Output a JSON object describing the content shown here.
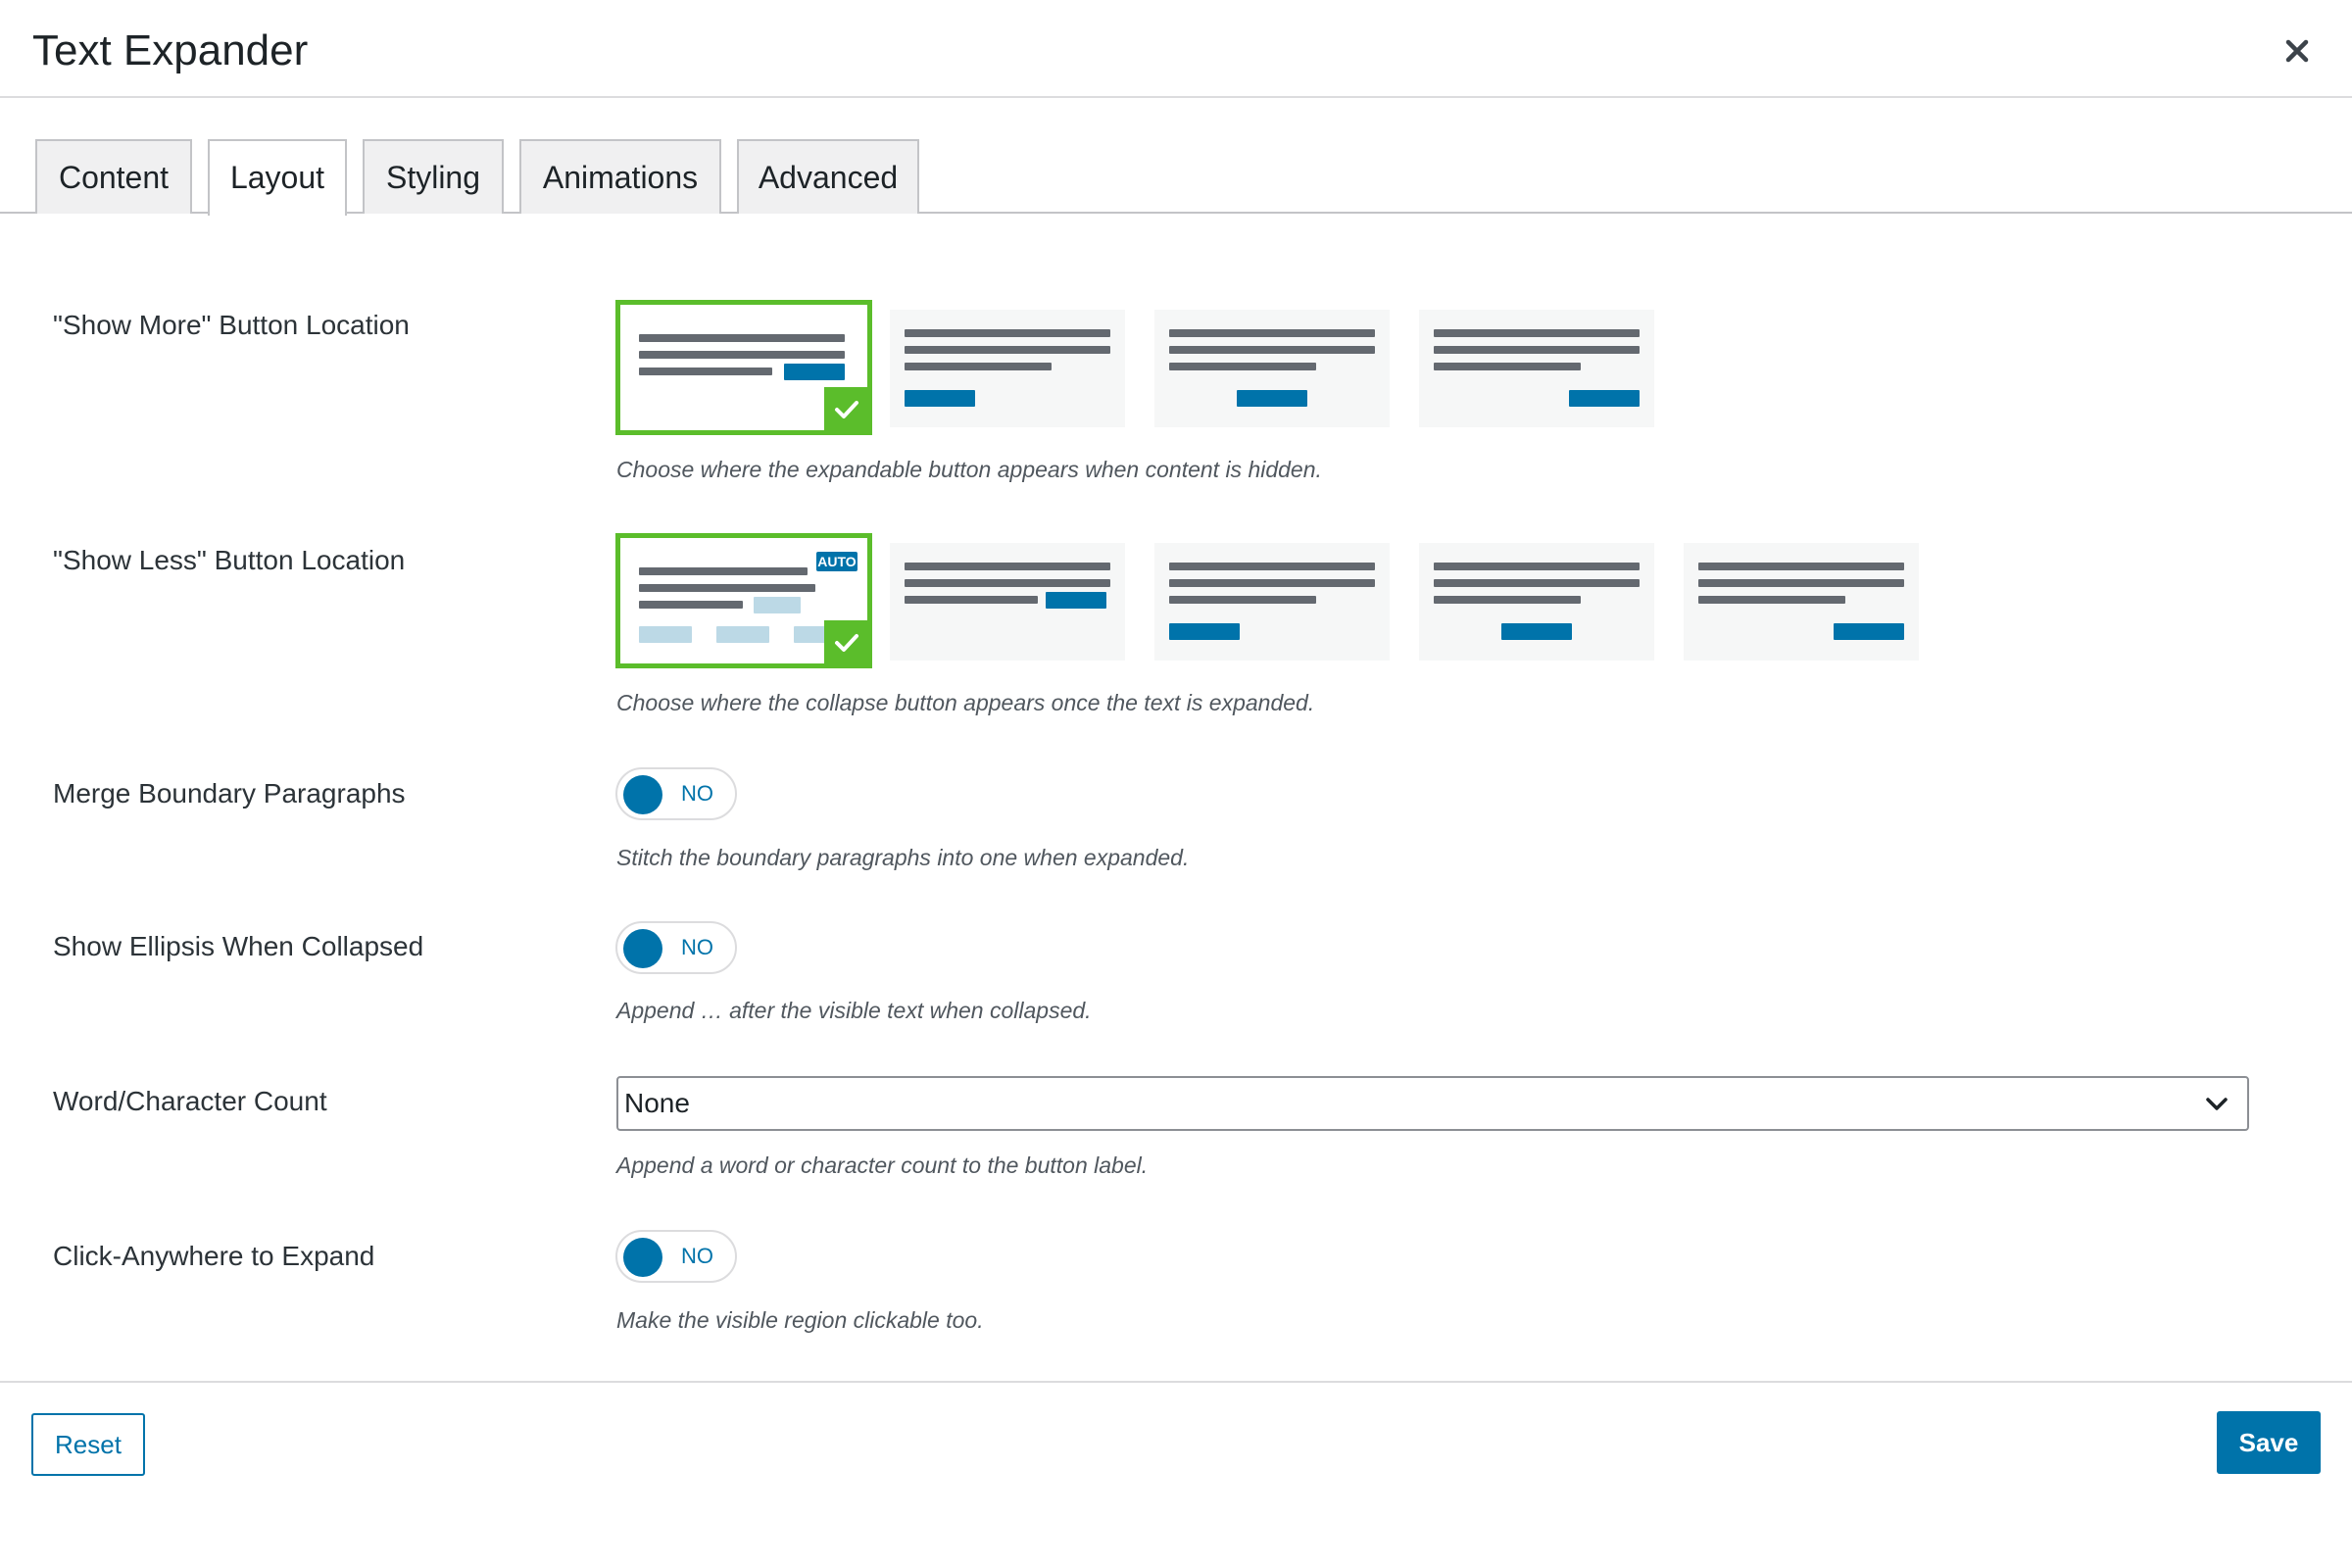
{
  "dialog": {
    "title": "Text Expander",
    "close_icon": "close-icon"
  },
  "tabs": [
    {
      "label": "Content",
      "active": false
    },
    {
      "label": "Layout",
      "active": true
    },
    {
      "label": "Styling",
      "active": false
    },
    {
      "label": "Animations",
      "active": false
    },
    {
      "label": "Advanced",
      "active": false
    }
  ],
  "show_more": {
    "label": "\"Show More\" Button Location",
    "help": "Choose where the expandable button appears when content is hidden.",
    "selected_index": 0,
    "option_count": 4
  },
  "show_less": {
    "label": "\"Show Less\" Button Location",
    "help": "Choose where the collapse button appears once the text is expanded.",
    "selected_index": 0,
    "option_count": 5,
    "auto_badge": "AUTO"
  },
  "merge": {
    "label": "Merge Boundary Paragraphs",
    "toggle": "NO",
    "help": "Stitch the boundary paragraphs into one when expanded."
  },
  "ellipsis": {
    "label": "Show Ellipsis When Collapsed",
    "toggle": "NO",
    "help": "Append … after the visible text when collapsed."
  },
  "count": {
    "label": "Word/Character Count",
    "value": "None",
    "help": "Append a word or character count to the button label."
  },
  "click_anywhere": {
    "label": "Click-Anywhere to Expand",
    "toggle": "NO",
    "help": "Make the visible region clickable too."
  },
  "footer": {
    "reset": "Reset",
    "save": "Save"
  },
  "colors": {
    "accent": "#0073aa",
    "selected": "#5bbd2b",
    "thumb_bg": "#f6f7f7"
  }
}
